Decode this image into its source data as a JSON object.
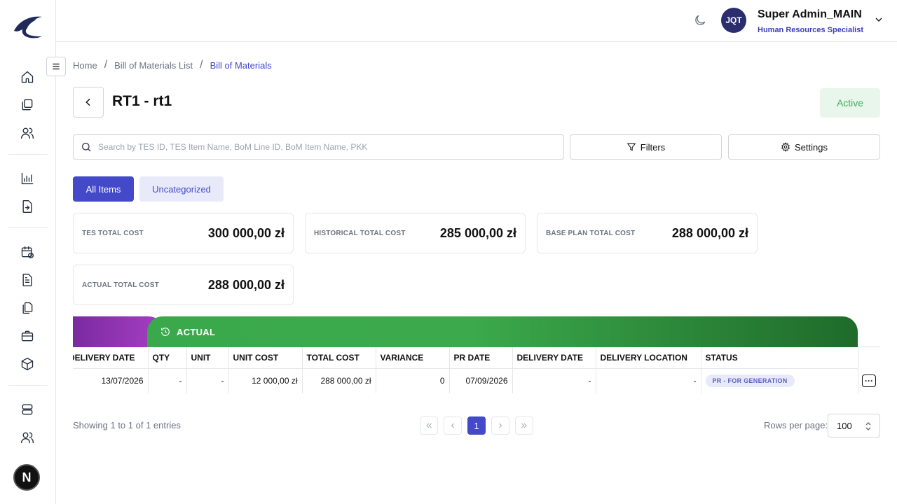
{
  "user": {
    "initials": "JQT",
    "name": "Super Admin_MAIN",
    "role": "Human Resources Specialist"
  },
  "breadcrumb": [
    "Home",
    "Bill of Materials List",
    "Bill of Materials"
  ],
  "page": {
    "title": "RT1 - rt1",
    "status": "Active"
  },
  "search": {
    "placeholder": "Search by TES ID, TES Item Name, BoM Line ID, BoM Item Name, PKK"
  },
  "toolbar": {
    "filters_label": "Filters",
    "settings_label": "Settings"
  },
  "tabs": [
    "All Items",
    "Uncategorized"
  ],
  "cost_cards": [
    {
      "label": "TES TOTAL COST",
      "value": "300 000,00 zł"
    },
    {
      "label": "HISTORICAL TOTAL COST",
      "value": "285 000,00 zł"
    },
    {
      "label": "BASE PLAN TOTAL COST",
      "value": "288 000,00 zł"
    },
    {
      "label": "ACTUAL TOTAL COST",
      "value": "288 000,00 zł"
    }
  ],
  "table": {
    "group_label": "ACTUAL",
    "columns": [
      "DELIVERY DATE",
      "QTY",
      "UNIT",
      "UNIT COST",
      "TOTAL COST",
      "VARIANCE",
      "PR DATE",
      "DELIVERY DATE",
      "DELIVERY LOCATION",
      "STATUS"
    ],
    "rows": [
      [
        "13/07/2026",
        "-",
        "-",
        "12 000,00 zł",
        "288 000,00 zł",
        "0",
        "07/09/2026",
        "-",
        "-",
        "PR - FOR GENERATION"
      ]
    ]
  },
  "pagination": {
    "showing": "Showing 1 to 1 of 1 entries",
    "current_page": "1",
    "rows_per_page_label": "Rows per page:",
    "rows_per_page": "100"
  },
  "badge_letter": "N"
}
